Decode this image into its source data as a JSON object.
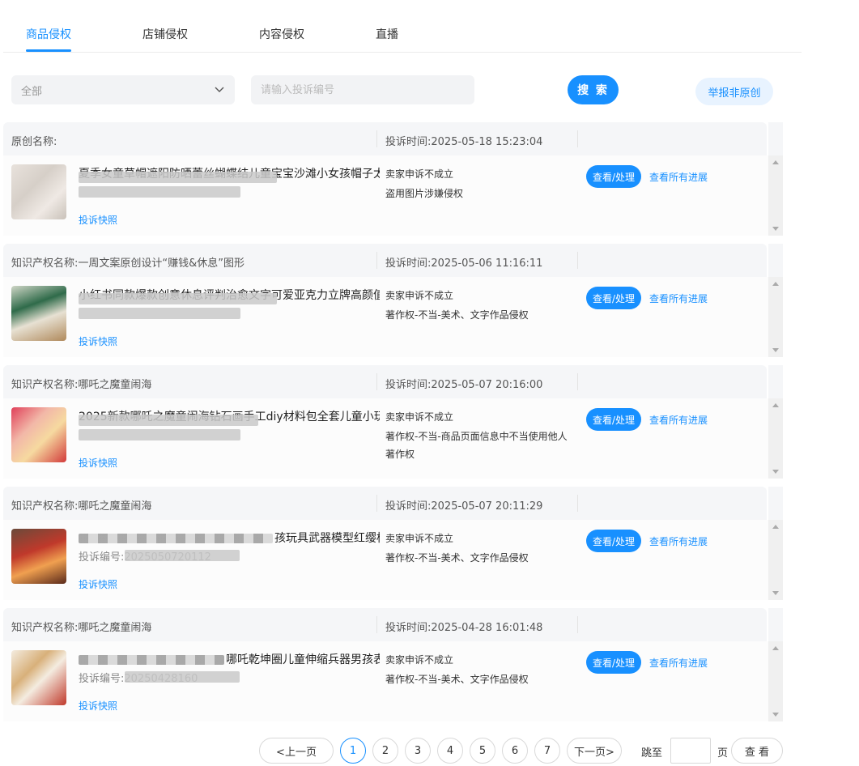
{
  "tabs": [
    {
      "label": "商品侵权",
      "active": true
    },
    {
      "label": "店铺侵权",
      "active": false
    },
    {
      "label": "内容侵权",
      "active": false
    },
    {
      "label": "直播",
      "active": false
    }
  ],
  "filter": {
    "select_value": "全部",
    "search_placeholder": "请输入投诉编号",
    "search_button": "搜 索",
    "report_button": "举报非原创"
  },
  "colors": {
    "accent": "#1890ff",
    "accent_light": "#e8f3ff",
    "header_bg": "#f5f6f8"
  },
  "complaints": [
    {
      "name": "原创名称:",
      "time": "投诉时间:2025-05-18 15:23:04",
      "product_title": "夏季女童草帽遮阳防晒蕾丝蝴蝶结儿童宝宝沙滩小女孩帽子太阳",
      "product_code": "",
      "snapshot": "投诉快照",
      "status": "卖家申诉不成立",
      "reason": "盗用图片涉嫌侵权",
      "action_button": "查看/处理",
      "progress_link": "查看所有进展"
    },
    {
      "name": "知识产权名称:一周文案原创设计“赚钱&休息”图形",
      "time": "投诉时间:2025-05-06 11:16:11",
      "product_title": "小红书同款爆款创意休息评判治愈文字可爱亚克力立牌高颜值",
      "product_code": "",
      "snapshot": "投诉快照",
      "status": "卖家申诉不成立",
      "reason": "著作权-不当-美术、文字作品侵权",
      "action_button": "查看/处理",
      "progress_link": "查看所有进展"
    },
    {
      "name": "知识产权名称:哪吒之魔童闹海",
      "time": "投诉时间:2025-05-07 20:16:00",
      "product_title": "2025新款哪吒之魔童闹海钻石画手工diy材料包全套儿童小玩",
      "product_code": "",
      "snapshot": "投诉快照",
      "status": "卖家申诉不成立",
      "reason": "著作权-不当-商品页面信息中不当使用他人著作权",
      "action_button": "查看/处理",
      "progress_link": "查看所有进展"
    },
    {
      "name": "知识产权名称:哪吒之魔童闹海",
      "time": "投诉时间:2025-05-07 20:11:29",
      "product_title": "孩玩具武器模型红缨枪",
      "product_code": "投诉编号:2025050720112",
      "snapshot": "投诉快照",
      "status": "卖家申诉不成立",
      "reason": "著作权-不当-美术、文字作品侵权",
      "action_button": "查看/处理",
      "progress_link": "查看所有进展"
    },
    {
      "name": "知识产权名称:哪吒之魔童闹海",
      "time": "投诉时间:2025-04-28 16:01:48",
      "product_title": "哪吒乾坤圈儿童伸缩兵器男孩表演",
      "product_code": "投诉编号:20250428160",
      "snapshot": "投诉快照",
      "status": "卖家申诉不成立",
      "reason": "著作权-不当-美术、文字作品侵权",
      "action_button": "查看/处理",
      "progress_link": "查看所有进展"
    }
  ],
  "pagination": {
    "prev": "<上一页",
    "pages": [
      "1",
      "2",
      "3",
      "4",
      "5",
      "6",
      "7"
    ],
    "current": "1",
    "next": "下一页>",
    "jump_label": "跳至",
    "page_unit": "页",
    "go_button": "查 看"
  }
}
